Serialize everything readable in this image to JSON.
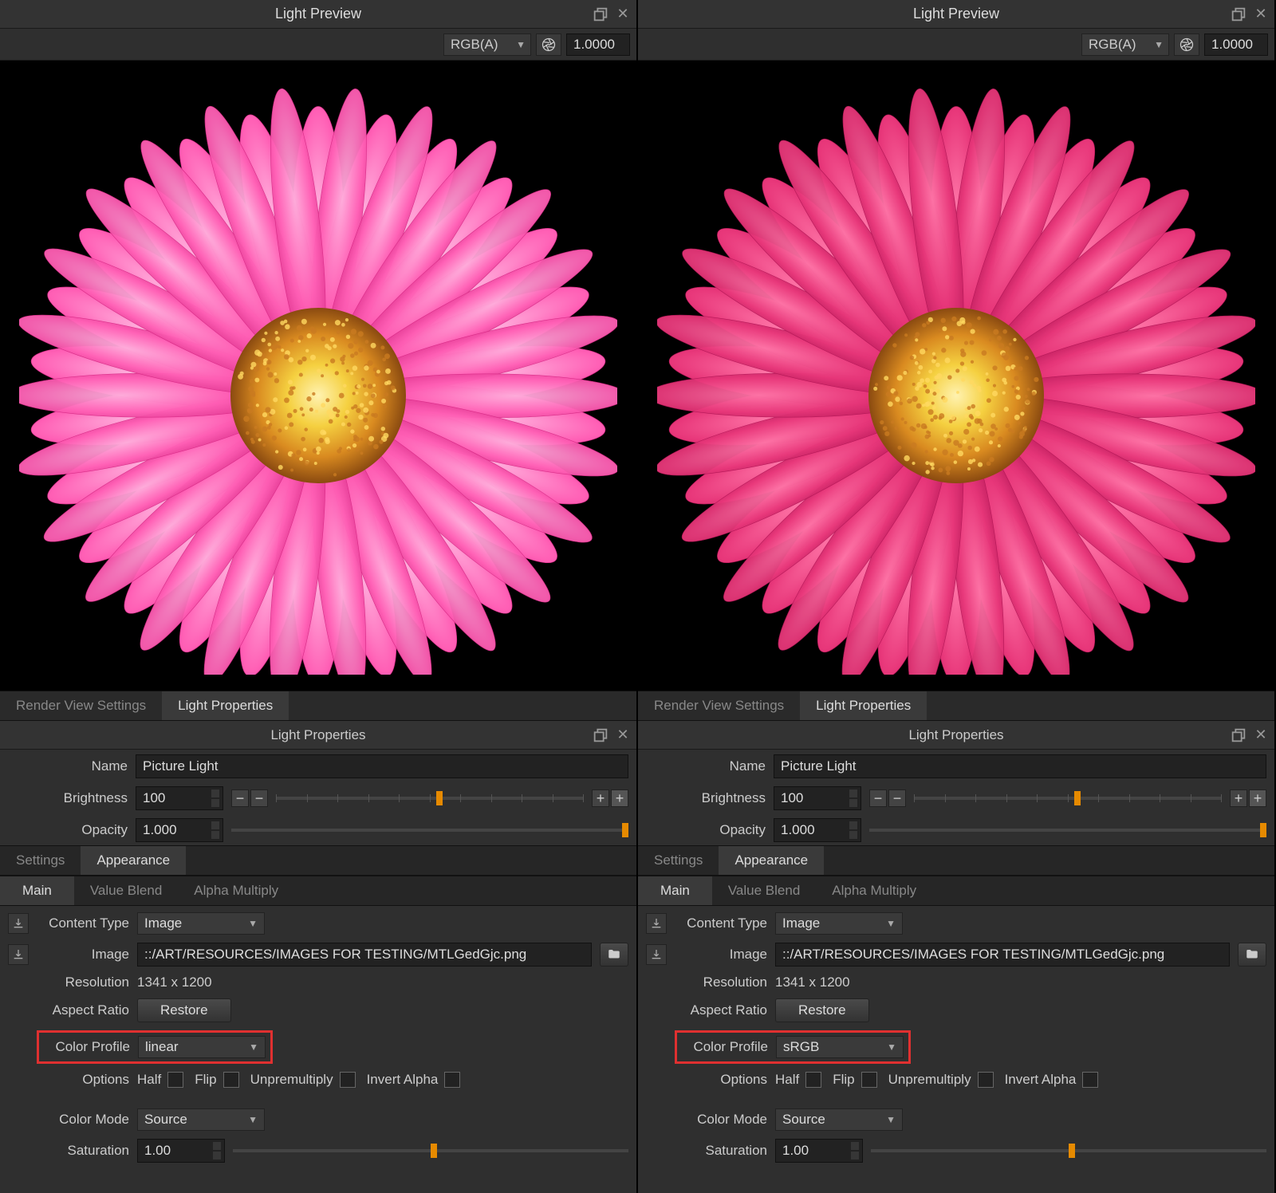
{
  "preview_title": "Light Preview",
  "channel_mode": "RGB(A)",
  "exposure_value": "1.0000",
  "top_tabs": {
    "render_view": "Render View Settings",
    "light_props": "Light Properties"
  },
  "props_title": "Light Properties",
  "fields": {
    "name_label": "Name",
    "name_value": "Picture Light",
    "brightness_label": "Brightness",
    "brightness_value": "100",
    "opacity_label": "Opacity",
    "opacity_value": "1.000"
  },
  "subtabs_top": {
    "settings": "Settings",
    "appearance": "Appearance"
  },
  "subtabs_app": {
    "main": "Main",
    "value_blend": "Value Blend",
    "alpha_multiply": "Alpha Multiply"
  },
  "content": {
    "content_type_label": "Content Type",
    "content_type_value": "Image",
    "image_label": "Image",
    "image_path": "::/ART/RESOURCES/IMAGES FOR TESTING/MTLGedGjc.png",
    "resolution_label": "Resolution",
    "resolution_value": "1341 x 1200",
    "aspect_label": "Aspect Ratio",
    "restore_btn": "Restore",
    "color_profile_label": "Color Profile",
    "options_label": "Options",
    "opt_half": "Half",
    "opt_flip": "Flip",
    "opt_unpre": "Unpremultiply",
    "opt_invert": "Invert Alpha",
    "color_mode_label": "Color Mode",
    "color_mode_value": "Source",
    "saturation_label": "Saturation",
    "saturation_value": "1.00"
  },
  "left": {
    "color_profile_value": "linear"
  },
  "right": {
    "color_profile_value": "sRGB"
  }
}
